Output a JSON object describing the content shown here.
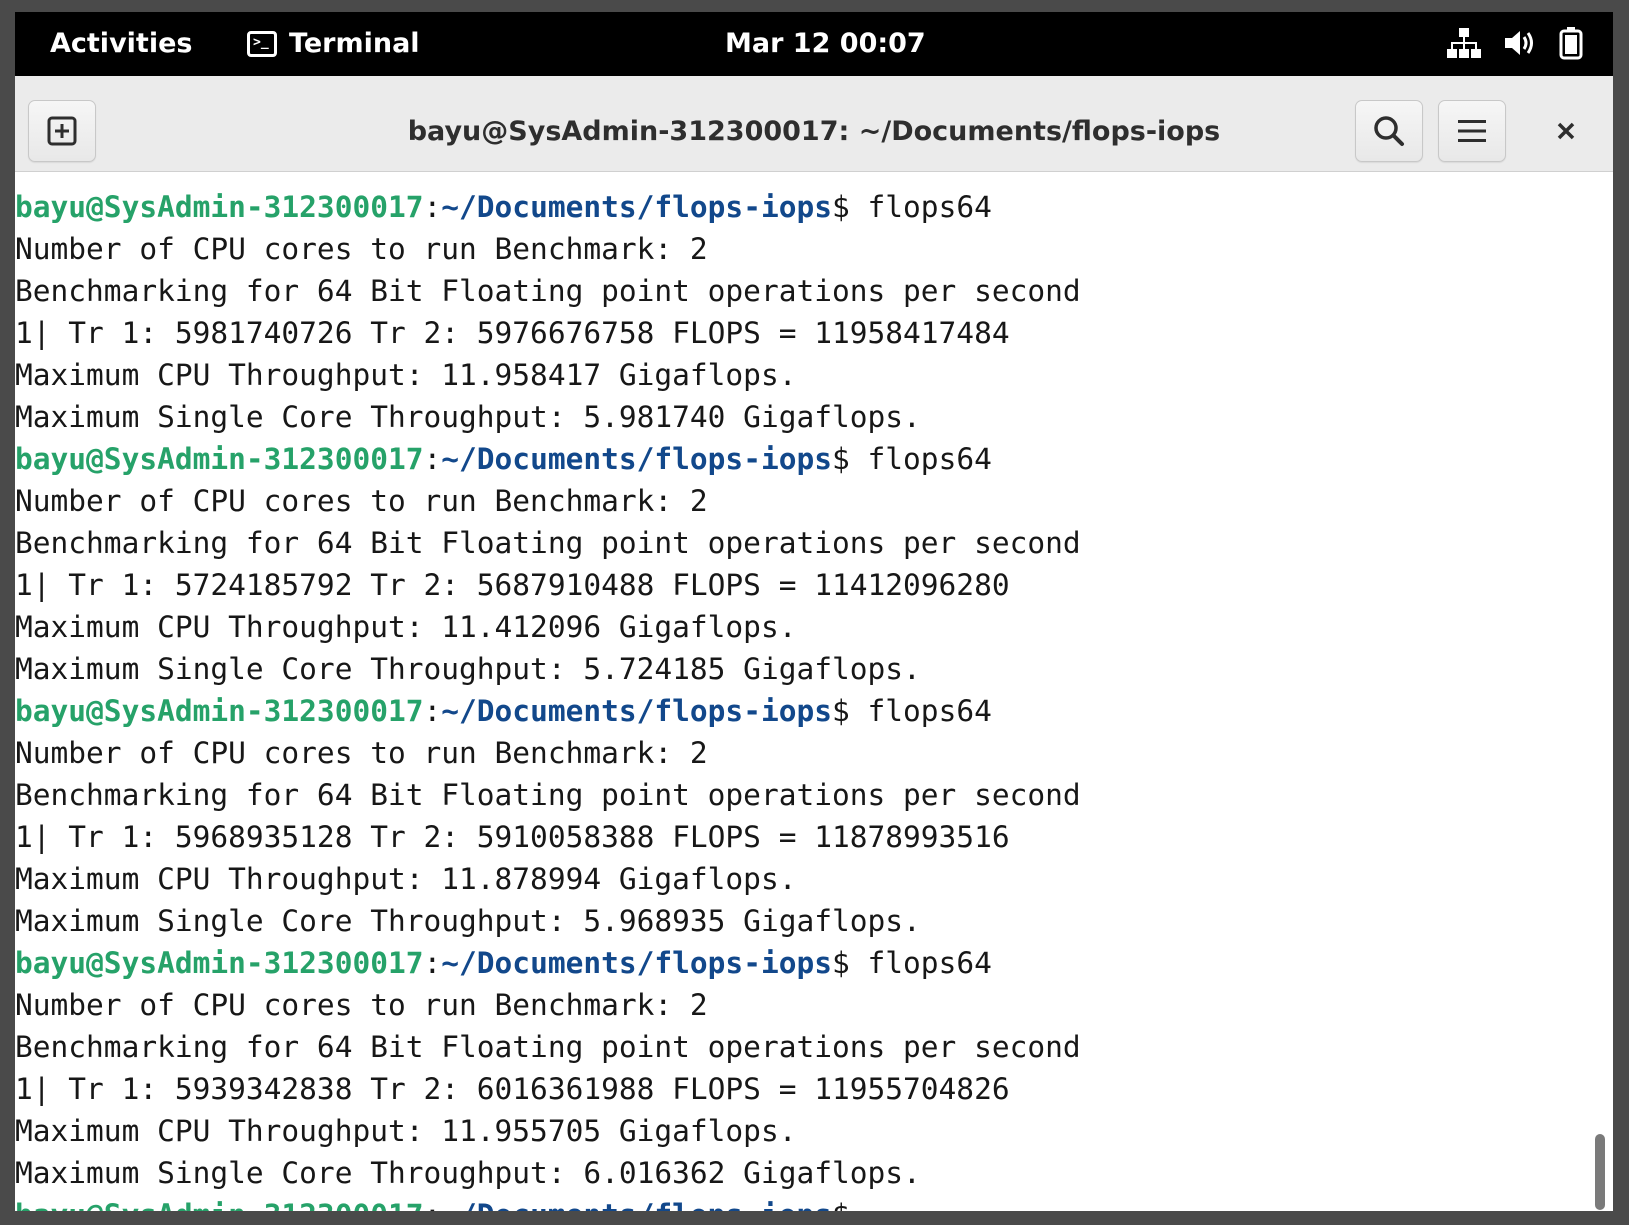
{
  "topbar": {
    "activities": "Activities",
    "app_name": "Terminal",
    "clock": "Mar 12  00:07",
    "icons": [
      "network-wired-icon",
      "volume-icon",
      "battery-icon"
    ]
  },
  "window": {
    "title": "bayu@SysAdmin-312300017: ~/Documents/flops-iops",
    "buttons": [
      "new-tab-icon",
      "search-icon",
      "hamburger-menu-icon",
      "close-icon"
    ]
  },
  "colors": {
    "prompt_user": "#26a269",
    "prompt_path": "#12488b",
    "text": "#171717"
  },
  "terminal": {
    "prompt_user": "bayu@SysAdmin-312300017",
    "prompt_sep": ":",
    "prompt_path": "~/Documents/flops-iops",
    "prompt_dollar": "$",
    "runs": [
      {
        "command": " flops64",
        "output": [
          "Number of CPU cores to run Benchmark: 2",
          "Benchmarking for 64 Bit Floating point operations per second",
          "1| Tr 1: 5981740726 Tr 2: 5976676758 FLOPS = 11958417484",
          "Maximum CPU Throughput: 11.958417 Gigaflops.",
          "Maximum Single Core Throughput: 5.981740 Gigaflops."
        ]
      },
      {
        "command": " flops64",
        "output": [
          "Number of CPU cores to run Benchmark: 2",
          "Benchmarking for 64 Bit Floating point operations per second",
          "1| Tr 1: 5724185792 Tr 2: 5687910488 FLOPS = 11412096280",
          "Maximum CPU Throughput: 11.412096 Gigaflops.",
          "Maximum Single Core Throughput: 5.724185 Gigaflops."
        ]
      },
      {
        "command": " flops64",
        "output": [
          "Number of CPU cores to run Benchmark: 2",
          "Benchmarking for 64 Bit Floating point operations per second",
          "1| Tr 1: 5968935128 Tr 2: 5910058388 FLOPS = 11878993516",
          "Maximum CPU Throughput: 11.878994 Gigaflops.",
          "Maximum Single Core Throughput: 5.968935 Gigaflops."
        ]
      },
      {
        "command": " flops64",
        "output": [
          "Number of CPU cores to run Benchmark: 2",
          "Benchmarking for 64 Bit Floating point operations per second",
          "1| Tr 1: 5939342838 Tr 2: 6016361988 FLOPS = 11955704826",
          "Maximum CPU Throughput: 11.955705 Gigaflops.",
          "Maximum Single Core Throughput: 6.016362 Gigaflops."
        ]
      }
    ],
    "final_prompt_command": ""
  }
}
